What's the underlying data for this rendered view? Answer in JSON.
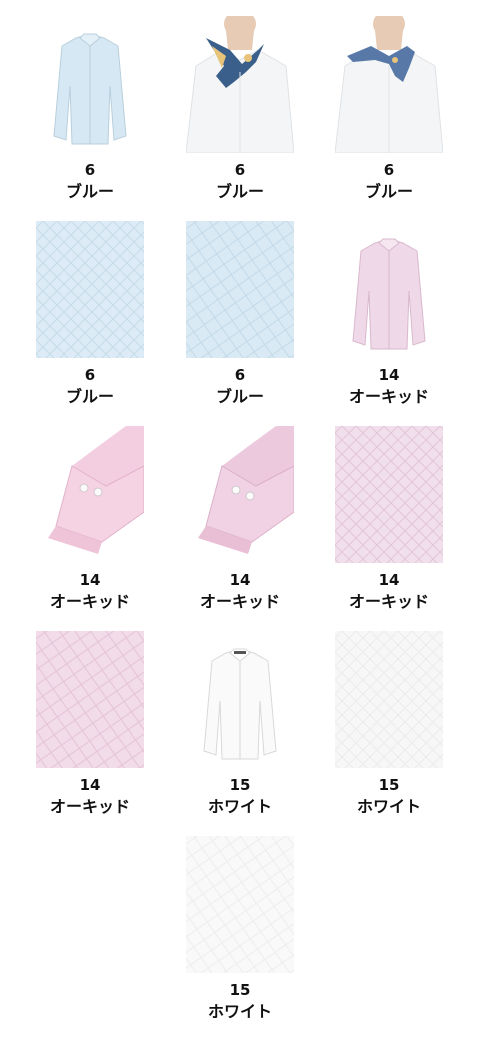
{
  "items": [
    {
      "code": "6",
      "color": "ブルー",
      "kind": "shirt",
      "fabric": "#d6e8f3"
    },
    {
      "code": "6",
      "color": "ブルー",
      "kind": "model-scarf",
      "fabric": "#f6f7f8"
    },
    {
      "code": "6",
      "color": "ブルー",
      "kind": "model-scarf-2",
      "fabric": "#f6f7f8"
    },
    {
      "code": "6",
      "color": "ブルー",
      "kind": "texture",
      "fabric": "#dcebf5"
    },
    {
      "code": "6",
      "color": "ブルー",
      "kind": "texture",
      "fabric": "#d9eaf4"
    },
    {
      "code": "14",
      "color": "オーキッド",
      "kind": "shirt",
      "fabric": "#efd9e8"
    },
    {
      "code": "14",
      "color": "オーキッド",
      "kind": "cuff",
      "fabric": "#f5d3e3"
    },
    {
      "code": "14",
      "color": "オーキッド",
      "kind": "cuff",
      "fabric": "#f0d2e4"
    },
    {
      "code": "14",
      "color": "オーキッド",
      "kind": "texture",
      "fabric": "#f2dfec"
    },
    {
      "code": "14",
      "color": "オーキッド",
      "kind": "texture",
      "fabric": "#f3dce9"
    },
    {
      "code": "15",
      "color": "ホワイト",
      "kind": "shirt",
      "fabric": "#fafafa"
    },
    {
      "code": "15",
      "color": "ホワイト",
      "kind": "texture",
      "fabric": "#f7f7f7"
    },
    {
      "code": "15",
      "color": "ホワイト",
      "kind": "texture",
      "fabric": "#f9f9f9"
    }
  ]
}
